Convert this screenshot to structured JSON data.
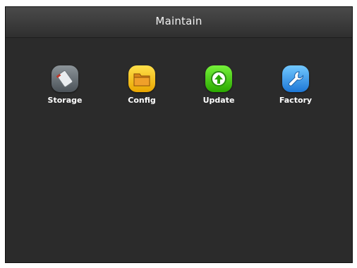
{
  "window": {
    "title": "Maintain"
  },
  "menu": {
    "items": [
      {
        "label": "Storage",
        "icon": "storage-icon",
        "color": "#5f676d"
      },
      {
        "label": "Config",
        "icon": "folder-icon",
        "color": "#f2bf1a"
      },
      {
        "label": "Update",
        "icon": "update-arrow-icon",
        "color": "#4ad11e"
      },
      {
        "label": "Factory",
        "icon": "wrench-icon",
        "color": "#3a98ea"
      }
    ]
  }
}
